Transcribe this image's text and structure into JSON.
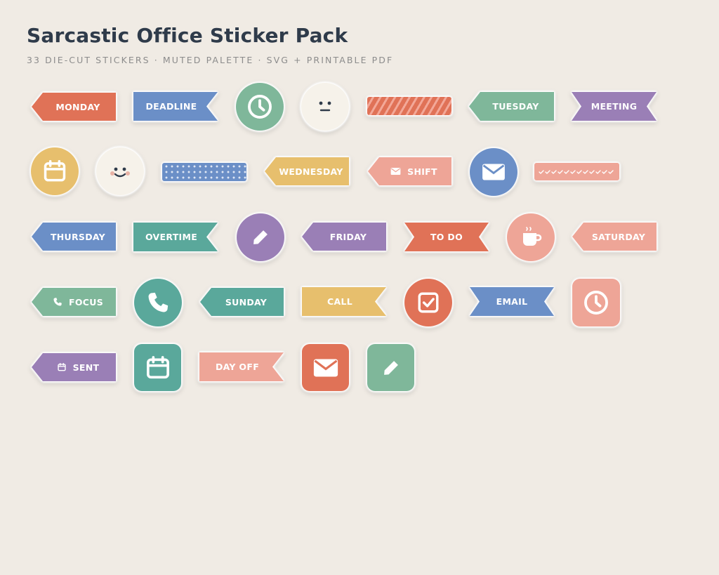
{
  "header": {
    "title": "Sarcastic Office Sticker Pack",
    "subtitle": "33 DIE-CUT STICKERS · MUTED PALETTE · SVG + PRINTABLE PDF"
  },
  "colors": {
    "background": "#f0ebe4",
    "coral": "#e07257",
    "blue": "#6b8fc7",
    "sage": "#7fb79a",
    "purple": "#9a7fb6",
    "mustard": "#e7bf6d",
    "pink": "#eea597",
    "teal": "#5aa89b",
    "cream": "#f6f2ea"
  },
  "stickers": {
    "monday": "MONDAY",
    "deadline": "DEADLINE",
    "tuesday": "TUESDAY",
    "meeting": "MEETING",
    "wednesday": "WEDNESDAY",
    "shift": "SHIFT",
    "thursday": "THURSDAY",
    "overtime": "OVERTIME",
    "friday": "FRIDAY",
    "todo": "TO DO",
    "saturday": "SATURDAY",
    "focus": "FOCUS",
    "sunday": "SUNDAY",
    "call": "CALL",
    "email": "EMAIL",
    "sent": "SENT",
    "dayoff": "DAY OFF"
  }
}
